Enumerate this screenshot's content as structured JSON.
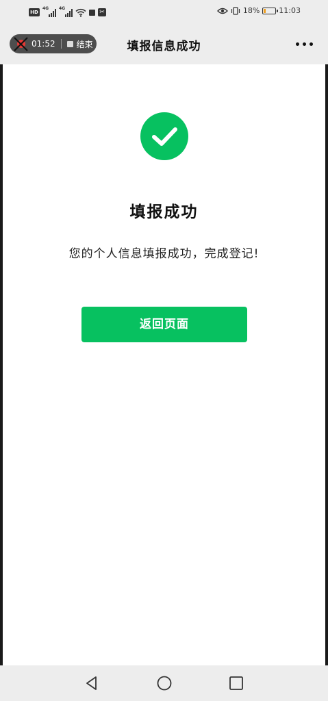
{
  "status_bar": {
    "hd": "HD",
    "network1": "4G",
    "network2": "4G",
    "battery_percent": "18%",
    "battery_level": 0.18,
    "time": "11:03",
    "icons": [
      "signal-icon",
      "wifi-icon",
      "screen-record-icon",
      "capcut-icon",
      "eye-icon",
      "vibrate-icon",
      "battery-icon"
    ]
  },
  "recorder": {
    "elapsed": "01:52",
    "end_label": "结束"
  },
  "header": {
    "title": "填报信息成功"
  },
  "result": {
    "title": "填报成功",
    "message": "您的个人信息填报成功，完成登记!"
  },
  "actions": {
    "back_label": "返回页面"
  },
  "colors": {
    "accent": "#07c160",
    "bar_background": "#ededed",
    "record_dot": "#e53935"
  }
}
